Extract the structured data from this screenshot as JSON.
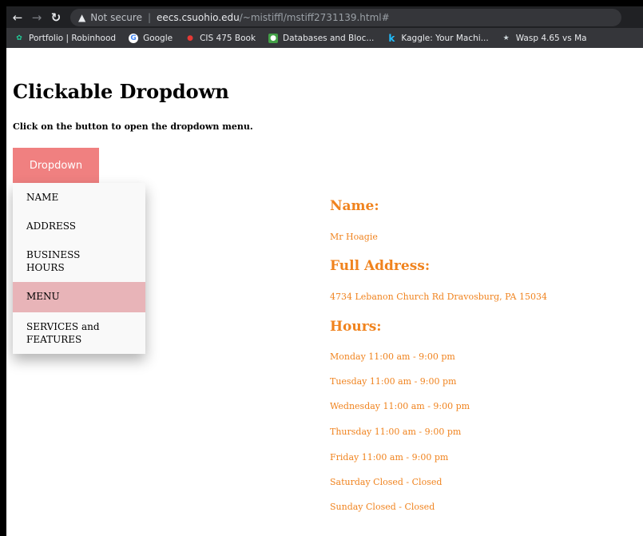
{
  "browser": {
    "security_label": "Not secure",
    "url_host": "eecs.csuohio.edu",
    "url_path": "/~mistiffl/mstiff2731139.html#",
    "bookmarks": [
      {
        "label": "Portfolio | Robinhood",
        "icon": "robinhood-icon",
        "color": "#21ce99"
      },
      {
        "label": "Google",
        "icon": "google-icon",
        "color": "#4285f4"
      },
      {
        "label": "CIS 475 Book",
        "icon": "book-icon",
        "color": "#e53935"
      },
      {
        "label": "Databases and Bloc...",
        "icon": "database-icon",
        "color": "#43a047"
      },
      {
        "label": "Kaggle: Your Machi...",
        "icon": "kaggle-icon",
        "color": "#20beff"
      },
      {
        "label": "Wasp 4.65 vs Ma",
        "icon": "wasp-icon",
        "color": "#cfd8dc"
      }
    ]
  },
  "page": {
    "title": "Clickable Dropdown",
    "subtitle": "Click on the button to open the dropdown menu.",
    "dropdown_label": "Dropdown",
    "menu": [
      {
        "label": "NAME"
      },
      {
        "label": "ADDRESS"
      },
      {
        "label": "BUSINESS HOURS"
      },
      {
        "label": "MENU"
      },
      {
        "label": "SERVICES and FEATURES"
      }
    ],
    "name_heading": "Name:",
    "name_value": "Mr Hoagie",
    "address_heading": "Full Address:",
    "address_value": "4734 Lebanon Church Rd Dravosburg, PA 15034",
    "hours_heading": "Hours:",
    "hours": [
      "Monday 11:00 am - 9:00 pm",
      "Tuesday 11:00 am - 9:00 pm",
      "Wednesday 11:00 am - 9:00 pm",
      "Thursday 11:00 am - 9:00 pm",
      "Friday 11:00 am - 9:00 pm",
      "Saturday Closed - Closed",
      "Sunday Closed - Closed"
    ]
  },
  "colors": {
    "accent": "#f08080",
    "info_text": "#f0831e",
    "menu_hover": "#e8b4b8"
  }
}
